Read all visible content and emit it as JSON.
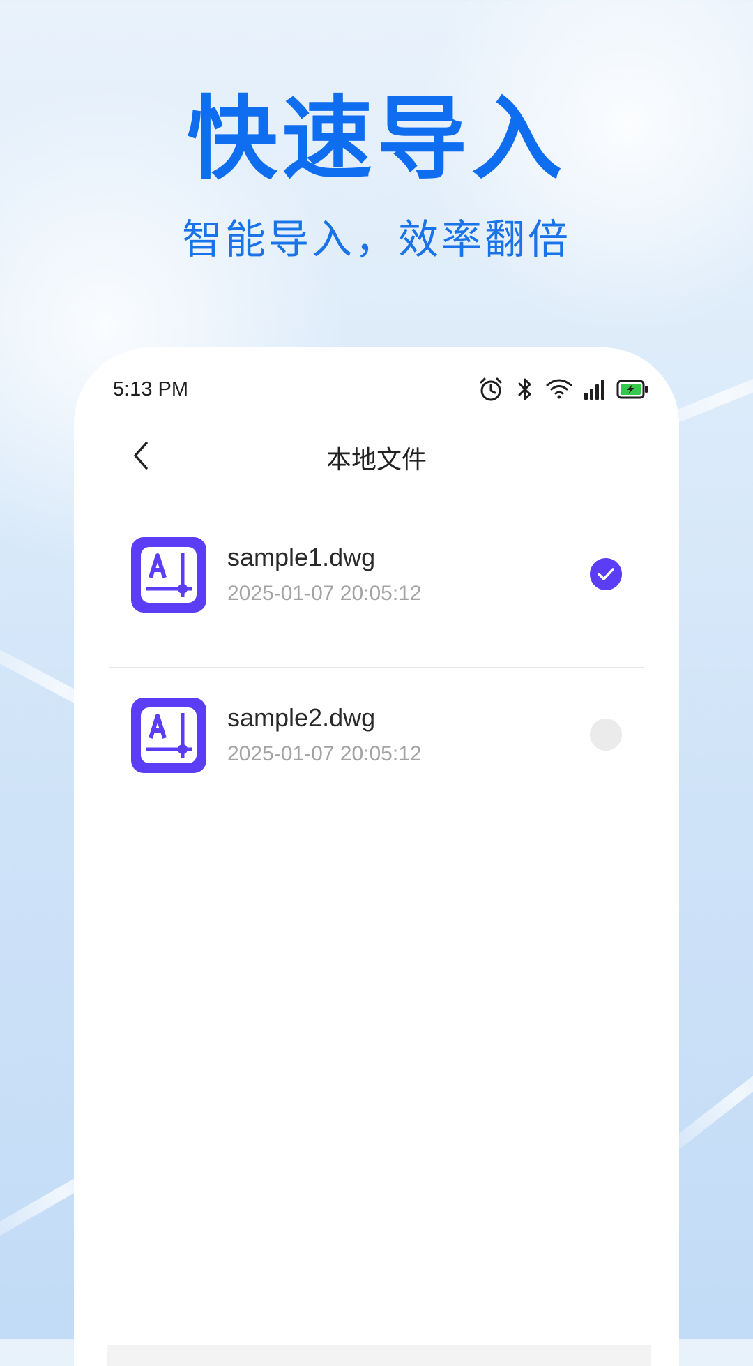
{
  "hero": {
    "title": "快速导入",
    "subtitle": "智能导入，效率翻倍"
  },
  "status_bar": {
    "time": "5:13 PM",
    "icons": [
      "alarm-icon",
      "bluetooth-icon",
      "wifi-icon",
      "signal-icon",
      "battery-charging-icon"
    ]
  },
  "nav": {
    "back_icon": "chevron-left-icon",
    "title": "本地文件"
  },
  "files": [
    {
      "name": "sample1.dwg",
      "date": "2025-01-07 20:05:12",
      "selected": true
    },
    {
      "name": "sample2.dwg",
      "date": "2025-01-07 20:05:12",
      "selected": false
    }
  ],
  "colors": {
    "brand_blue": "#0f6df0",
    "accent_purple": "#5a3df5",
    "battery_green": "#35c84a"
  }
}
